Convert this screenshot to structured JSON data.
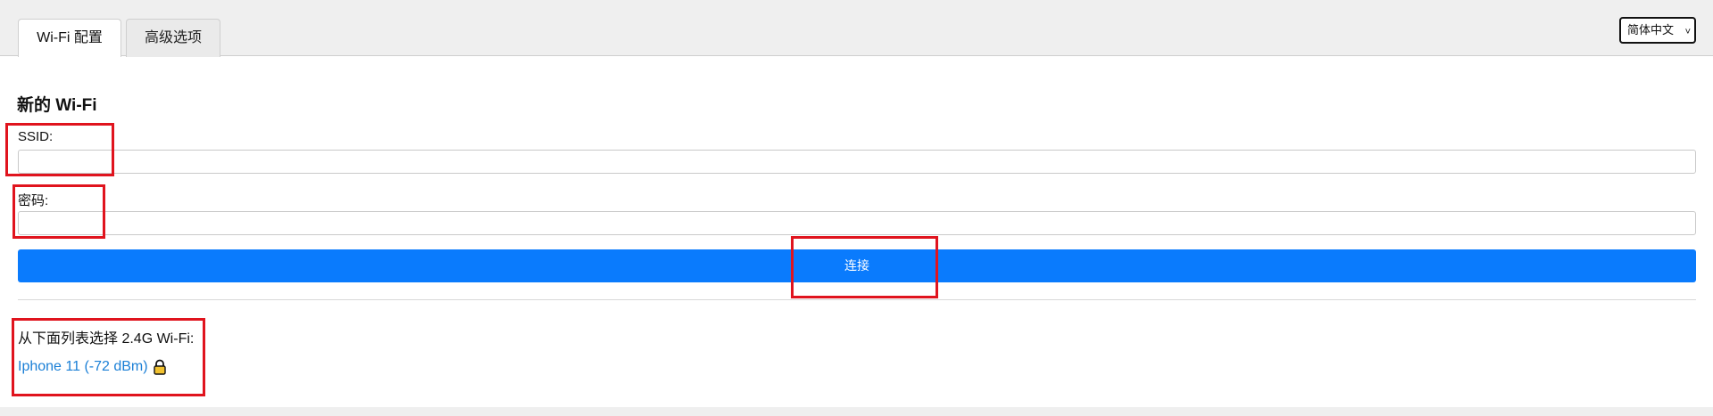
{
  "tabs": [
    {
      "label": "Wi-Fi 配置",
      "active": true
    },
    {
      "label": "高级选项",
      "active": false
    }
  ],
  "language": {
    "selected": "简体中文"
  },
  "form": {
    "title": "新的 Wi-Fi",
    "ssid_label": "SSID:",
    "ssid_value": "",
    "password_label": "密码:",
    "password_value": "",
    "connect_label": "连接"
  },
  "networks": {
    "caption": "从下面列表选择 2.4G Wi-Fi:",
    "items": [
      {
        "label": "Iphone 11 (-72 dBm)",
        "secured": true,
        "icon": "lock-icon"
      }
    ]
  },
  "colors": {
    "accent": "#0a7bfd",
    "link": "#1a7fd6",
    "annotation": "#e0141e",
    "lock": "#f2c230"
  }
}
